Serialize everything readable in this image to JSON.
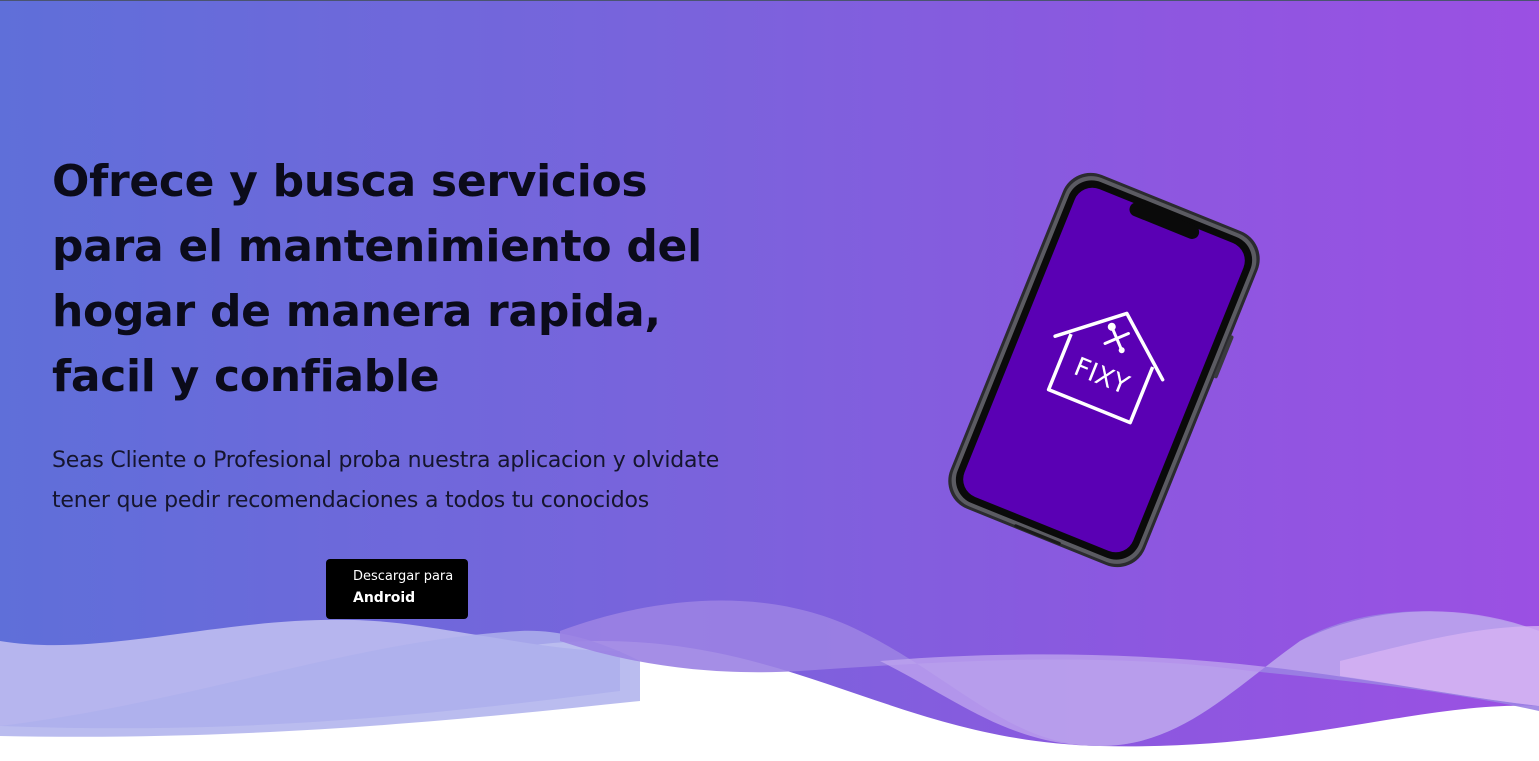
{
  "hero": {
    "headline": "Ofrece y busca servicios para el mantenimiento del hogar de manera rapida, facil y confiable",
    "subtitle": "Seas Cliente o Profesional proba nuestra aplicacion y olvidate tener que pedir recomendaciones a todos tu conocidos",
    "download_button": {
      "pre_label": "Descargar para",
      "platform_label": "Android"
    }
  },
  "phone_mockup": {
    "app_logo_text": "FIXY",
    "screen_color": "#5a00b4"
  },
  "colors": {
    "gradient_start": "#5f6fd9",
    "gradient_end": "#9b50e3",
    "headline_text": "#0b0b1a",
    "button_bg": "#000000"
  },
  "icons": [
    "house-tools-logo-icon"
  ]
}
